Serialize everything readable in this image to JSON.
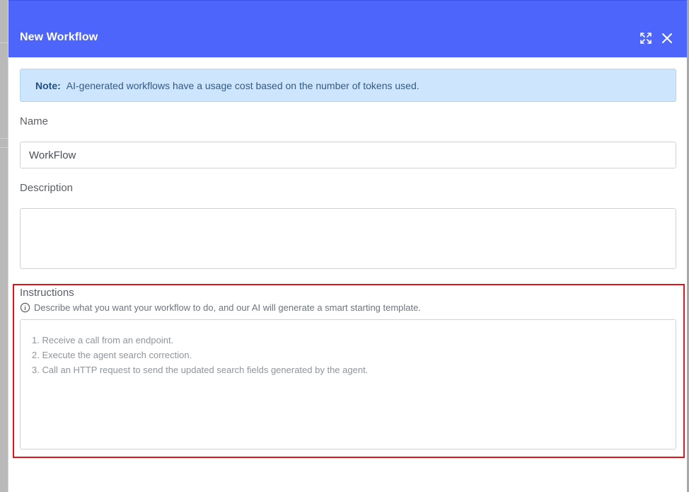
{
  "modal": {
    "title": "New Workflow"
  },
  "icons": {
    "expand": "expand-arrows-icon",
    "close": "close-x-icon",
    "info": "info-circle-icon"
  },
  "note": {
    "label": "Note:",
    "text": "AI-generated workflows have a usage cost based on the number of tokens used."
  },
  "form": {
    "name_label": "Name",
    "name_value": "WorkFlow",
    "description_label": "Description",
    "description_value": "",
    "instructions_label": "Instructions",
    "instructions_hint": "Describe what you want your workflow to do, and our AI will generate a smart starting template.",
    "instructions_placeholder": "1. Receive a call from an endpoint.\n2. Execute the agent search correction.\n3. Call an HTTP request to send the updated search fields generated by the agent."
  },
  "colors": {
    "header_bg": "#4d65fb",
    "note_bg": "#cde5fd",
    "highlight_border": "#e0141b"
  }
}
